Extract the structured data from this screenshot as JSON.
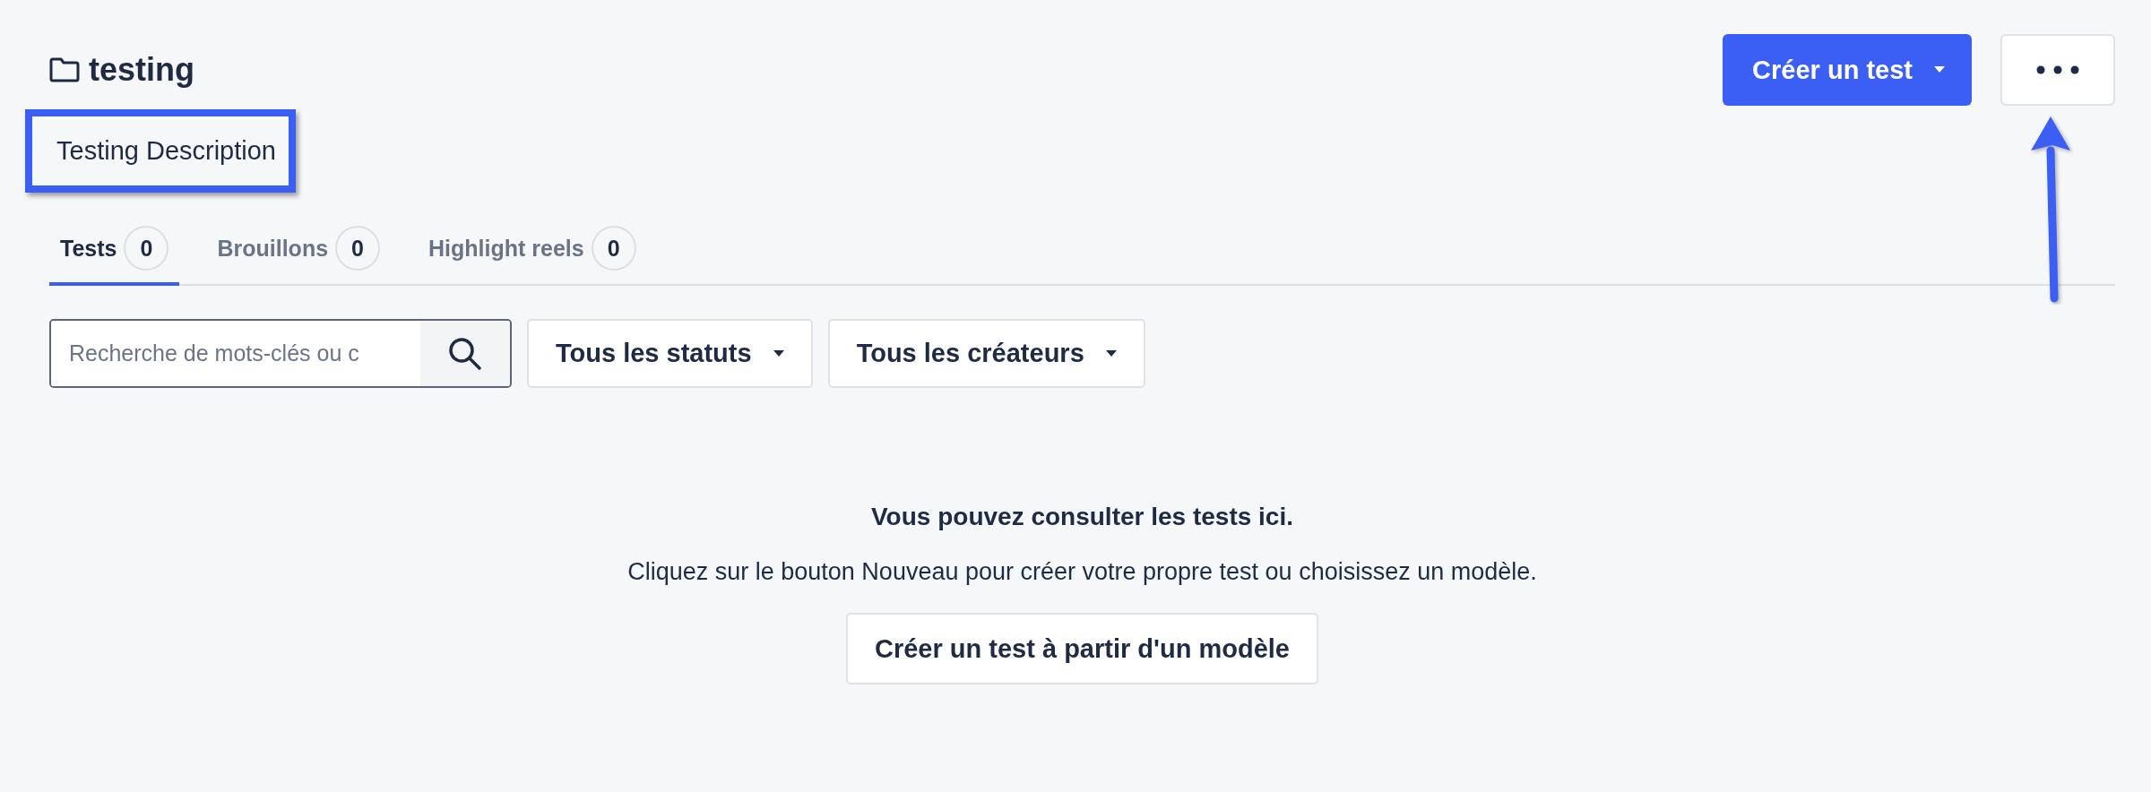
{
  "folder": {
    "title": "testing",
    "description": "Testing Description",
    "description_highlighted": true
  },
  "actions": {
    "create_label": "Créer un test",
    "more_highlighted": true
  },
  "tabs": [
    {
      "label": "Tests",
      "count": "0",
      "selected": true
    },
    {
      "label": "Brouillons",
      "count": "0",
      "selected": false
    },
    {
      "label": "Highlight reels",
      "count": "0",
      "selected": false
    }
  ],
  "search": {
    "placeholder": "Recherche de mots-clés ou c"
  },
  "filters": [
    {
      "label": "Tous les statuts"
    },
    {
      "label": "Tous les créateurs"
    }
  ],
  "empty_state": {
    "heading": "Vous pouvez consulter les tests ici.",
    "text": "Cliquez sur le bouton Nouveau pour créer votre propre test ou choisissez un modèle.",
    "button": "Créer un test à partir d'un modèle"
  }
}
